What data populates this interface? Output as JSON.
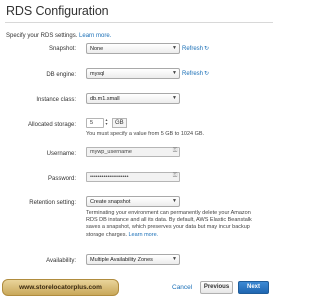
{
  "page": {
    "title": "RDS Configuration",
    "intro_text": "Specify your RDS settings.",
    "learn_more": "Learn more."
  },
  "form": {
    "snapshot": {
      "label": "Snapshot:",
      "value": "None",
      "refresh": "Refresh"
    },
    "db_engine": {
      "label": "DB engine:",
      "value": "mysql",
      "refresh": "Refresh"
    },
    "instance_class": {
      "label": "Instance class:",
      "value": "db.m1.small"
    },
    "allocated_storage": {
      "label": "Allocated storage:",
      "value": "5",
      "unit": "GB",
      "hint": "You must specify a value from 5 GB to 1024 GB."
    },
    "username": {
      "label": "Username:",
      "value": "mywp_username"
    },
    "password": {
      "label": "Password:",
      "value": "••••••••••••••••••••"
    },
    "retention": {
      "label": "Retention setting:",
      "value": "Create snapshot",
      "note_line1": "Terminating your environment can permanently delete your Amazon",
      "note_line2": "RDS DB instance and all its data. By default, AWS Elastic Beanstalk",
      "note_line3": "saves a snapshot, which preserves your data but may incur backup",
      "note_line4": "storage charges.",
      "note_link": "Learn more."
    },
    "availability": {
      "label": "Availability:",
      "value": "Multiple Availability Zones"
    }
  },
  "footer": {
    "watermark": "www.storelocatorplus.com",
    "cancel": "Cancel",
    "previous": "Previous",
    "next": "Next"
  },
  "colors": {
    "link": "#1a6fb7",
    "primary_button": "#2a74c0"
  },
  "icons": {
    "refresh": "refresh-icon",
    "key": "key-icon",
    "dropdown": "chevron-down-icon"
  }
}
